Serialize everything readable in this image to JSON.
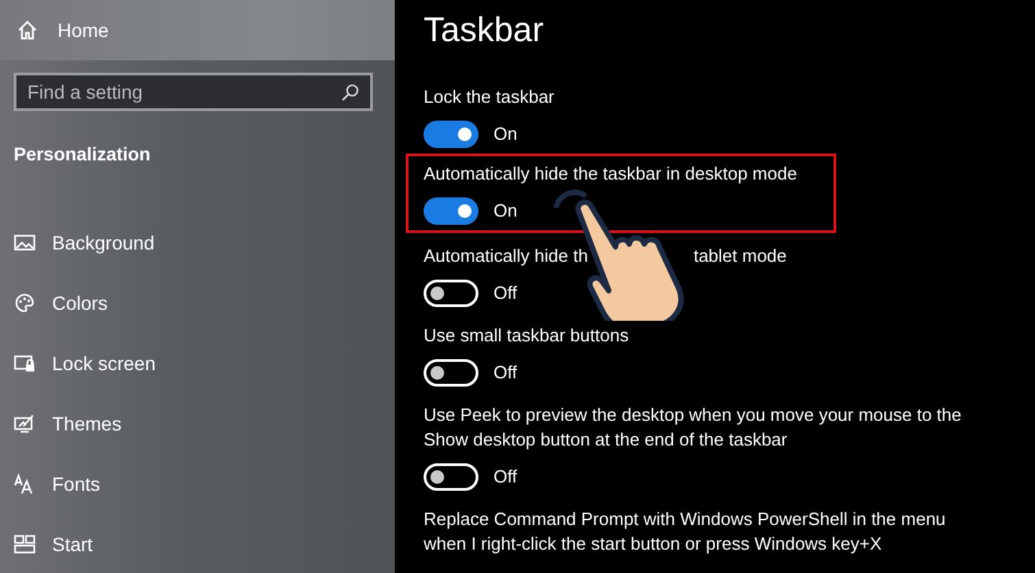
{
  "sidebar": {
    "home": "Home",
    "search": {
      "placeholder": "Find a setting"
    },
    "section": "Personalization",
    "items": [
      {
        "label": "Background"
      },
      {
        "label": "Colors"
      },
      {
        "label": "Lock screen"
      },
      {
        "label": "Themes"
      },
      {
        "label": "Fonts"
      },
      {
        "label": "Start"
      }
    ]
  },
  "page": {
    "title": "Taskbar",
    "settings": [
      {
        "label": "Lock the taskbar",
        "on": true,
        "state_text": "On",
        "highlighted": false
      },
      {
        "label": "Automatically hide the taskbar in desktop mode",
        "on": true,
        "state_text": "On",
        "highlighted": true
      },
      {
        "label_parts": [
          "Automatically hide th",
          "tablet mode"
        ],
        "on": false,
        "state_text": "Off",
        "highlighted": false
      },
      {
        "label": "Use small taskbar buttons",
        "on": false,
        "state_text": "Off",
        "highlighted": false
      },
      {
        "label": "Use Peek to preview the desktop when you move your mouse to the Show desktop button at the end of the taskbar",
        "on": false,
        "state_text": "Off",
        "highlighted": false
      },
      {
        "label": "Replace Command Prompt with Windows PowerShell in the menu when I right-click the start button or press Windows key+X",
        "highlighted": false
      }
    ]
  }
}
